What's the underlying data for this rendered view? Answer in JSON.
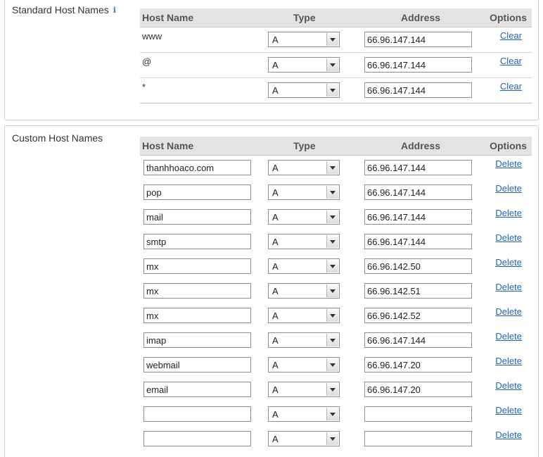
{
  "standard": {
    "title": "Standard Host Names",
    "info_icon": "i",
    "headers": {
      "name": "Host Name",
      "type": "Type",
      "address": "Address",
      "options": "Options"
    },
    "rows": [
      {
        "name": "www",
        "type": "A",
        "address": "66.96.147.144",
        "option": "Clear"
      },
      {
        "name": "@",
        "type": "A",
        "address": "66.96.147.144",
        "option": "Clear"
      },
      {
        "name": "*",
        "type": "A",
        "address": "66.96.147.144",
        "option": "Clear"
      }
    ]
  },
  "custom": {
    "title": "Custom Host Names",
    "headers": {
      "name": "Host Name",
      "type": "Type",
      "address": "Address",
      "options": "Options"
    },
    "rows": [
      {
        "name": "thanhhoaco.com",
        "type": "A",
        "address": "66.96.147.144",
        "option": "Delete"
      },
      {
        "name": "pop",
        "type": "A",
        "address": "66.96.147.144",
        "option": "Delete"
      },
      {
        "name": "mail",
        "type": "A",
        "address": "66.96.147.144",
        "option": "Delete"
      },
      {
        "name": "smtp",
        "type": "A",
        "address": "66.96.147.144",
        "option": "Delete"
      },
      {
        "name": "mx",
        "type": "A",
        "address": "66.96.142.50",
        "option": "Delete"
      },
      {
        "name": "mx",
        "type": "A",
        "address": "66.96.142.51",
        "option": "Delete"
      },
      {
        "name": "mx",
        "type": "A",
        "address": "66.96.142.52",
        "option": "Delete"
      },
      {
        "name": "imap",
        "type": "A",
        "address": "66.96.147.144",
        "option": "Delete"
      },
      {
        "name": "webmail",
        "type": "A",
        "address": "66.96.147.20",
        "option": "Delete"
      },
      {
        "name": "email",
        "type": "A",
        "address": "66.96.147.20",
        "option": "Delete"
      },
      {
        "name": "",
        "type": "A",
        "address": "",
        "option": "Delete"
      },
      {
        "name": "",
        "type": "A",
        "address": "",
        "option": "Delete"
      }
    ]
  }
}
